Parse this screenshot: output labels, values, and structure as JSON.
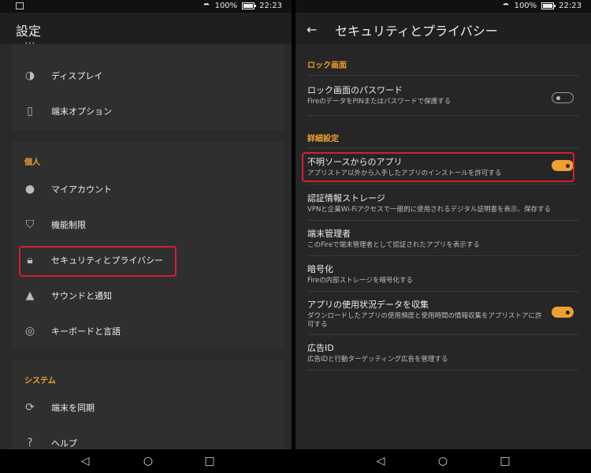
{
  "status": {
    "battery": "100%",
    "time": "22:23"
  },
  "left": {
    "title": "設定",
    "items_top": [
      {
        "label": "ディスプレイ",
        "icon": "display-icon"
      },
      {
        "label": "端末オプション",
        "icon": "device-icon"
      }
    ],
    "personal_header": "個人",
    "personal_items": [
      {
        "label": "マイアカウント",
        "icon": "person-icon"
      },
      {
        "label": "機能制限",
        "icon": "shield-icon"
      },
      {
        "label": "セキュリティとプライバシー",
        "icon": "lock-icon"
      },
      {
        "label": "サウンドと通知",
        "icon": "bell-icon"
      },
      {
        "label": "キーボードと言語",
        "icon": "globe-icon"
      }
    ],
    "system_header": "システム",
    "system_items": [
      {
        "label": "端末を同期",
        "icon": "sync-icon"
      },
      {
        "label": "ヘルプ",
        "icon": "help-icon"
      }
    ]
  },
  "right": {
    "title": "セキュリティとプライバシー",
    "lock_section": "ロック画面",
    "lock_password": {
      "title": "ロック画面のパスワード",
      "subtitle": "FireのデータをPINまたはパスワードで保護する",
      "toggle": false
    },
    "advanced_section": "詳細設定",
    "items": [
      {
        "title": "不明ソースからのアプリ",
        "subtitle": "アプリストア以外から入手したアプリのインストールを許可する",
        "toggle": true
      },
      {
        "title": "認証情報ストレージ",
        "subtitle": "VPNと企業Wi-Fiアクセスで一般的に使用されるデジタル証明書を表示、保存する"
      },
      {
        "title": "端末管理者",
        "subtitle": "このFireで端末管理者として認証されたアプリを表示する"
      },
      {
        "title": "暗号化",
        "subtitle": "Fireの内部ストレージを暗号化する"
      },
      {
        "title": "アプリの使用状況データを収集",
        "subtitle": "ダウンロードしたアプリの使用頻度と使用時間の情報収集をアプリストアに許可する",
        "toggle": true
      },
      {
        "title": "広告ID",
        "subtitle": "広告IDと行動ターゲッティング広告を管理する"
      }
    ]
  },
  "colors": {
    "accent": "#f0a030",
    "highlight": "#d2202e"
  }
}
